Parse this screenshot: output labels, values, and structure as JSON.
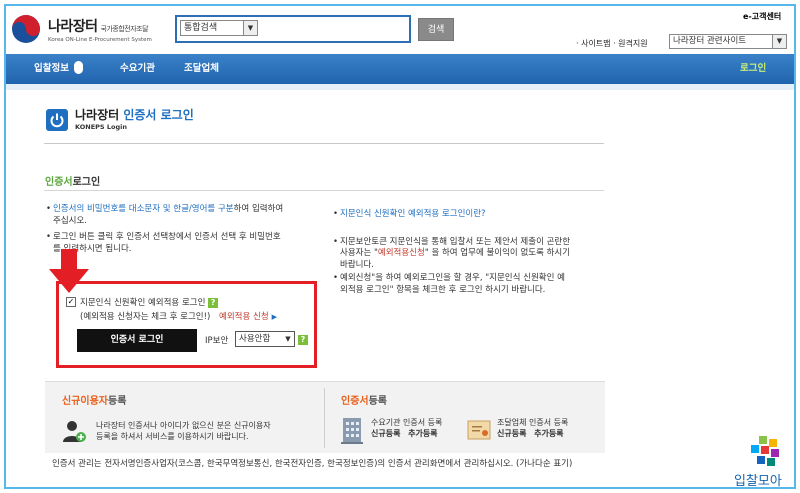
{
  "header": {
    "logo_title": "나라장터",
    "logo_subtitle_ko": "국가종합전자조달",
    "logo_subtitle_en": "Korea ON-Line E-Procurement System",
    "search_scope": "통합검색",
    "search_button": "검색",
    "customer_center": "e-고객센터",
    "util_links": "· 사이트맵 · 원격지원",
    "related_sites": "나라장터 관련사이트"
  },
  "nav": {
    "items": [
      "입찰정보",
      "수요기관",
      "조달업체"
    ],
    "login": "로그인"
  },
  "title": {
    "prefix": "나라장터 ",
    "highlight": "인증서 로그인",
    "subtitle": "KONEPS Login"
  },
  "section": {
    "heading_green": "인증서",
    "heading_rest": "로그인"
  },
  "left_bullets": {
    "b1_p1": "인증서의 비밀번호를 대소문자 및 한글/영어를 구분",
    "b1_p2": "하여 입력하여",
    "b1_p3": "주십시오.",
    "b2_l1": "로그인 버튼 클릭 후 인증서 선택창에서 인증서 선택 후 비밀번호",
    "b2_l2": "를 입력하시면 됩니다."
  },
  "right_bullets": {
    "fingerprint_link": "지문인식 신원확인 예외적용 로그인이란?",
    "b2_l1": "지문보안토큰 지문인식을 통해 입찰서 또는 제안서 제출이 곤란한",
    "b2_l2a": "사용자는 \"",
    "b2_l2b": "예외적용신청",
    "b2_l2c": "\" 을 하여 업무에 불이익이 없도록 하시기",
    "b2_l3": "바랍니다.",
    "b3_l1": "예외신청\"을 하여 예외로그인을 할 경우, \"지문인식 신원확인 예",
    "b3_l2": "외적용 로그인\" 항목을 체크한 후 로그인 하시기 바랍니다."
  },
  "login_form": {
    "checked": true,
    "check_mark": "✓",
    "fingerprint_checkbox_label": "지문인식 신원확인 예외적용 로그인",
    "help": "?",
    "exception_note": "(예외적용 신청자는 체크 후 로그인!)",
    "exception_link": "예외적용 신청",
    "login_button": "인증서 로그인",
    "ip_label": "IP보안",
    "ip_value": "사용안함"
  },
  "panels": {
    "signup_heading_orange": "신규이용자",
    "signup_heading_rest": "등록",
    "signup_text_l1": "나라장터 인증서나 아이디가 없으신 분은 신규이용자",
    "signup_text_l2": "등록을 하셔서 서비스를 이용하시기 바랍니다.",
    "cert_heading_orange": "인증서",
    "cert_heading_rest": "등록",
    "agency_title": "수요기관 인증서 등록",
    "agency_link1": "신규등록",
    "agency_link2": "추가등록",
    "vendor_title": "조달업체 인증서 등록",
    "vendor_link1": "신규등록",
    "vendor_link2": "추가등록"
  },
  "footer": {
    "note": "인증서 관리는 전자서명인증사업자(코스콤, 한국무역정보통신, 한국전자인증, 한국정보인증)의 인증서 관리화면에서 관리하십시오. (가나다순 표기)"
  },
  "brand": {
    "text": "입찰모아"
  },
  "colors": {
    "nav_blue": "#1f64ad",
    "accent_blue": "#1f6fc0",
    "highlight_red": "#e31e24",
    "green": "#5aa53c",
    "orange": "#e8601c",
    "frame_blue": "#55b7ea"
  }
}
